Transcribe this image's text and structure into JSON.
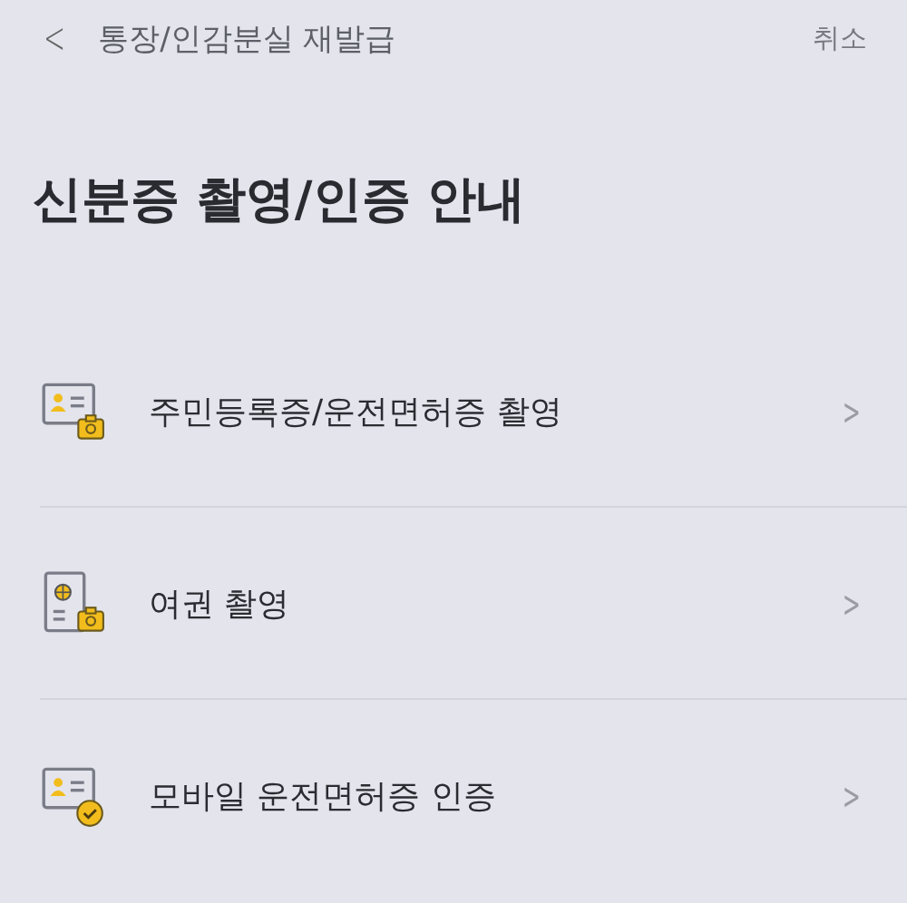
{
  "header": {
    "back": "<",
    "title": "통장/인감분실 재발급",
    "cancel": "취소"
  },
  "heading": "신분증 촬영/인증 안내",
  "items": [
    {
      "kind": "id-camera",
      "label": "주민등록증/운전면허증 촬영",
      "arrow": ">"
    },
    {
      "kind": "passport-camera",
      "label": "여권 촬영",
      "arrow": ">"
    },
    {
      "kind": "id-check",
      "label": "모바일 운전면허증 인증",
      "arrow": ">"
    }
  ]
}
